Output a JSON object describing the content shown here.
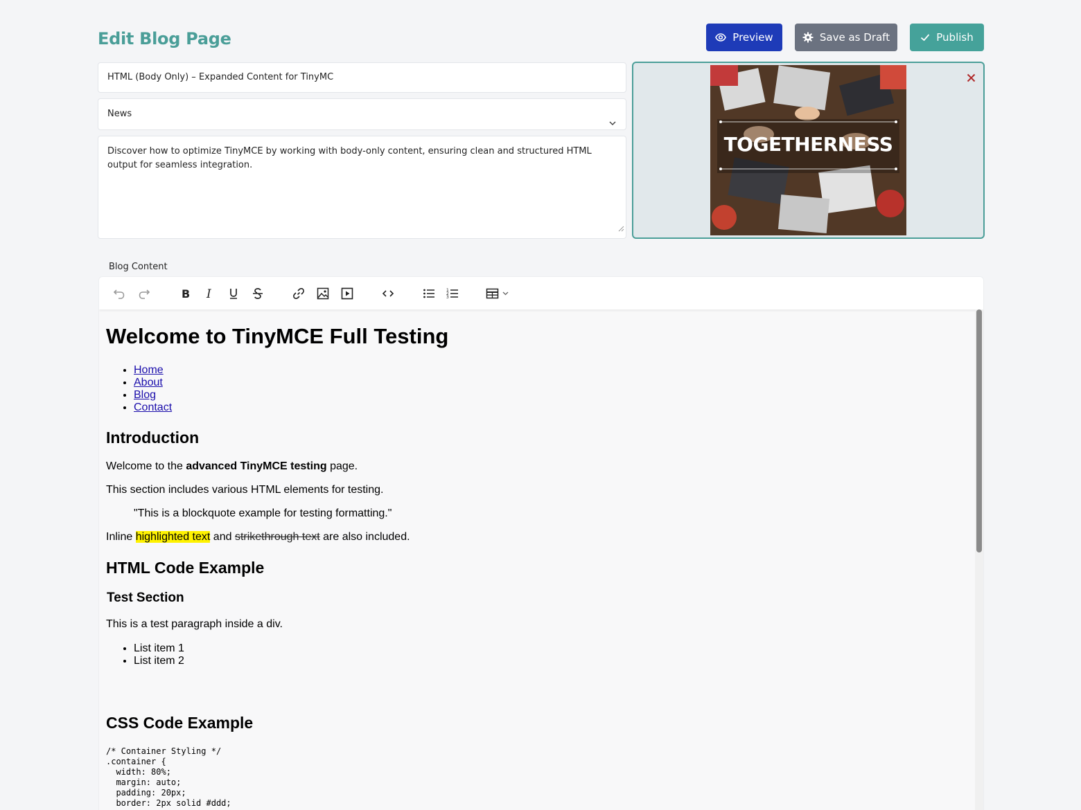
{
  "header": {
    "title": "Edit Blog Page",
    "preview_label": "Preview",
    "draft_label": "Save as Draft",
    "publish_label": "Publish"
  },
  "form": {
    "title_value": "HTML (Body Only) – Expanded Content for TinyMC",
    "category_value": "News",
    "excerpt_value": "Discover how to optimize TinyMCE by working with body-only content, ensuring clean and structured HTML output for seamless integration.",
    "content_label": "Blog Content"
  },
  "featured_image": {
    "overlay_text": "TOGETHERNESS"
  },
  "toolbar": {
    "buttons": [
      "undo-icon",
      "redo-icon",
      "bold-icon",
      "italic-icon",
      "underline-icon",
      "strikethrough-icon",
      "link-icon",
      "image-icon",
      "media-icon",
      "code-icon",
      "bullet-list-icon",
      "numbered-list-icon",
      "table-icon"
    ]
  },
  "content": {
    "h1": "Welcome to TinyMCE Full Testing",
    "nav_links": [
      "Home",
      "About",
      "Blog",
      "Contact"
    ],
    "intro_heading": "Introduction",
    "p1_pre": "Welcome to the ",
    "p1_bold": "advanced TinyMCE testing",
    "p1_post": " page.",
    "p2": "This section includes various HTML elements for testing.",
    "quote": "\"This is a blockquote example for testing formatting.\"",
    "p3_pre": "Inline ",
    "p3_highlight": "highlighted text",
    "p3_mid": " and ",
    "p3_strike": "strikethrough text",
    "p3_post": " are also included.",
    "html_heading": "HTML Code Example",
    "test_heading": "Test Section",
    "test_paragraph": "This is a test paragraph inside a div.",
    "list_items": [
      "List item 1",
      "List item 2"
    ],
    "css_heading": "CSS Code Example",
    "css_code": "/* Container Styling */\n.container {\n  width: 80%;\n  margin: auto;\n  padding: 20px;\n  border: 2px solid #ddd;"
  },
  "colors": {
    "accent": "#4a9e98",
    "preview_button": "#1e3bb8",
    "draft_button": "#6b7280",
    "publish_button": "#45a29a",
    "close_icon": "#b02a2a",
    "highlight": "#fff200"
  }
}
